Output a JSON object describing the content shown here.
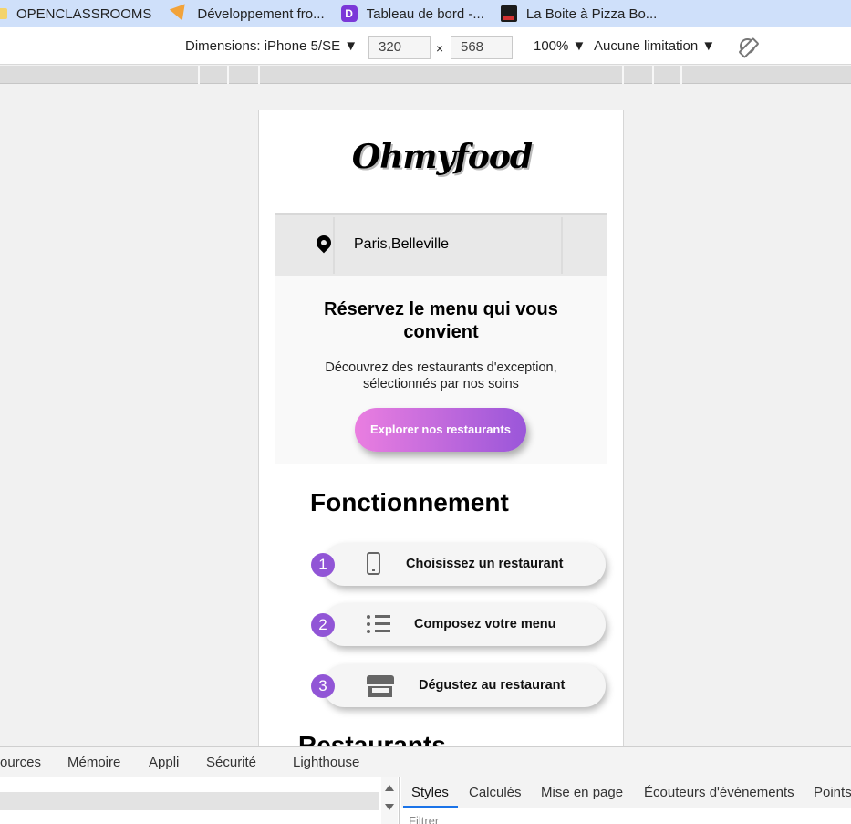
{
  "bookmarks": [
    {
      "label": "OPENCLASSROOMS",
      "icon": "folder-icon"
    },
    {
      "label": "Développement fro...",
      "icon": "triangle-icon"
    },
    {
      "label": "Tableau de bord -...",
      "icon": "purple-logo-icon"
    },
    {
      "label": "La Boite à Pizza Bo...",
      "icon": "pizza-icon"
    }
  ],
  "device_toolbar": {
    "dimensions_label": "Dimensions: iPhone 5/SE ▼",
    "width": "320",
    "times": "×",
    "height": "568",
    "zoom": "100% ▼",
    "throttle": "Aucune limitation ▼"
  },
  "site": {
    "logo": "Ohmyfood",
    "location": "Paris,Belleville",
    "hero_title": "Réservez le menu qui vous convient",
    "hero_subtitle": "Découvrez des restaurants d'exception, sélectionnés par nos soins",
    "hero_button": "Explorer nos restaurants",
    "how_title": "Fonctionnement",
    "steps": [
      {
        "num": "1",
        "label": "Choisissez un restaurant",
        "icon": "phone-icon"
      },
      {
        "num": "2",
        "label": "Composez votre menu",
        "icon": "list-icon"
      },
      {
        "num": "3",
        "label": "Dégustez au restaurant",
        "icon": "store-icon"
      }
    ],
    "restaurants_title": "Restaurants"
  },
  "devtools": {
    "tabs": [
      "ources",
      "Mémoire",
      "Appli",
      "Sécurité",
      "Lighthouse"
    ],
    "side_tabs": [
      "Styles",
      "Calculés",
      "Mise en page",
      "Écouteurs d'événements",
      "Points"
    ],
    "filter": "Filtrer"
  }
}
